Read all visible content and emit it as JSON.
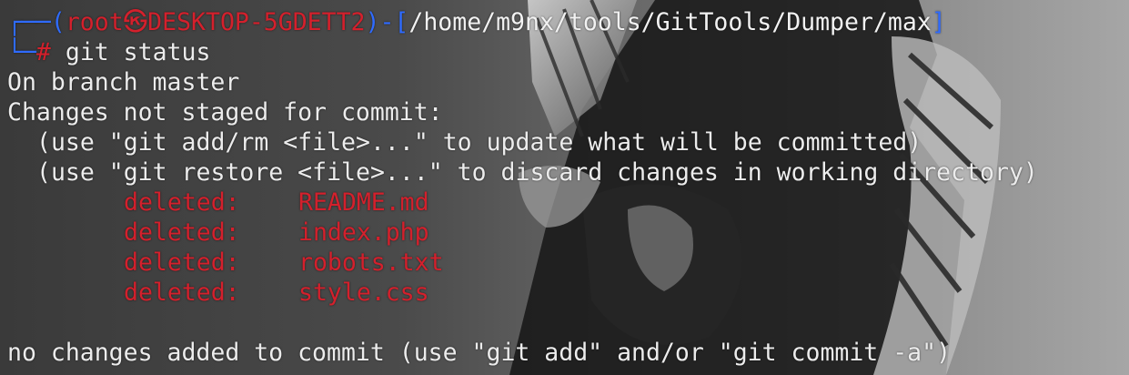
{
  "prompt": {
    "corner_top": "┌──",
    "corner_bottom": "└─",
    "open_paren": "(",
    "user": "root",
    "host_symbol": "㉿",
    "host": "DESKTOP-5GDETT2",
    "close_paren_dash": ")-[",
    "path": "/home/m9nx/tools/GitTools/Dumper/max",
    "close_bracket": "]",
    "hash": "#",
    "command": "git status"
  },
  "output": {
    "branch_line": "On branch master",
    "changes_header": "Changes not staged for commit:",
    "hint1": "(use \"git add/rm <file>...\" to update what will be committed)",
    "hint2": "(use \"git restore <file>...\" to discard changes in working directory)",
    "deleted_label": "deleted:",
    "deleted_files": [
      "README.md",
      "index.php",
      "robots.txt",
      "style.css"
    ],
    "footer": "no changes added to commit (use \"git add\" and/or \"git commit -a\")"
  },
  "colors": {
    "prompt_blue": "#2f6bff",
    "prompt_red": "#d4202c",
    "text": "#ececec"
  }
}
